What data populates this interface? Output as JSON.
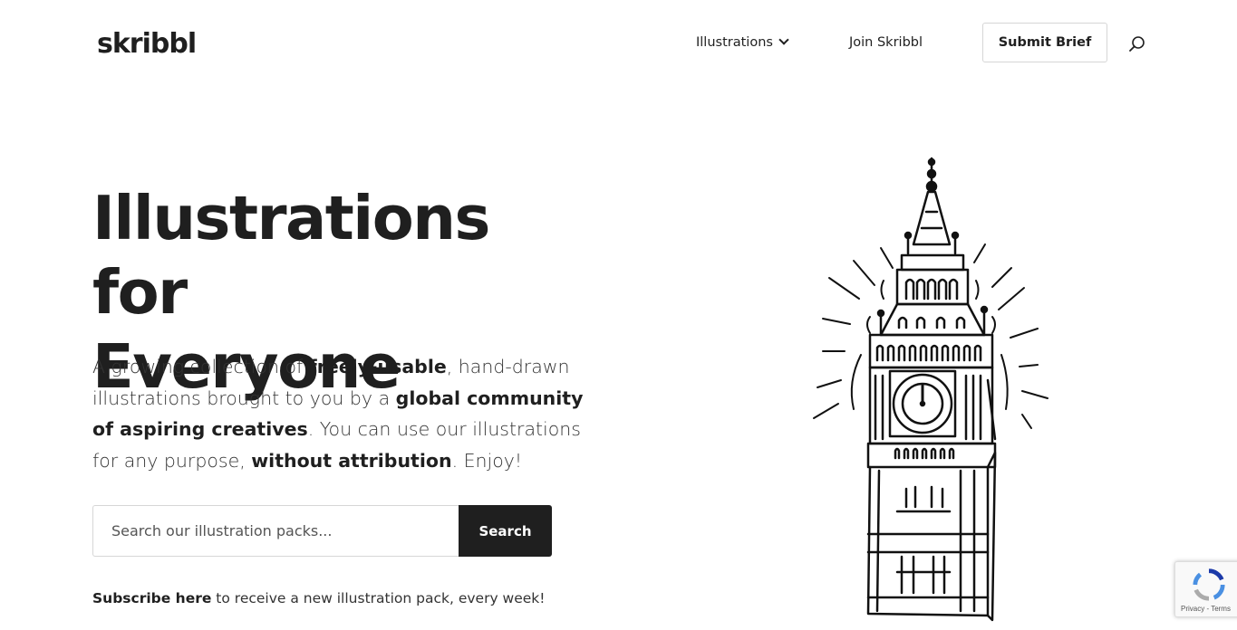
{
  "header": {
    "logo": "skribbl",
    "nav": {
      "illustrations_label": "Illustrations",
      "join_label": "Join Skribbl",
      "submit_label": "Submit Brief"
    },
    "search_icon": "search-icon"
  },
  "hero": {
    "title_line1": "Illustrations for",
    "title_line2": "Everyone",
    "intro": {
      "p1": "A growing collection of ",
      "b1": "freely-usable",
      "p2": ", hand-drawn illustrations brought to you by a ",
      "b2": "global community of aspiring creatives",
      "p3": ". You can use our illustrations for any purpose, ",
      "b3": "without attribution",
      "p4": ". Enjoy!"
    },
    "search": {
      "placeholder": "Search our illustration packs...",
      "button_label": "Search"
    },
    "subscribe": {
      "link": "Subscribe here",
      "rest": " to receive a new illustration pack, every week!"
    },
    "illustration": "big-ben-tower-illustration"
  },
  "recaptcha": {
    "text": "Privacy - Terms"
  },
  "colors": {
    "text": "#1f1f1f",
    "button_dark": "#1f1f1f",
    "border": "#d6d6d6"
  }
}
